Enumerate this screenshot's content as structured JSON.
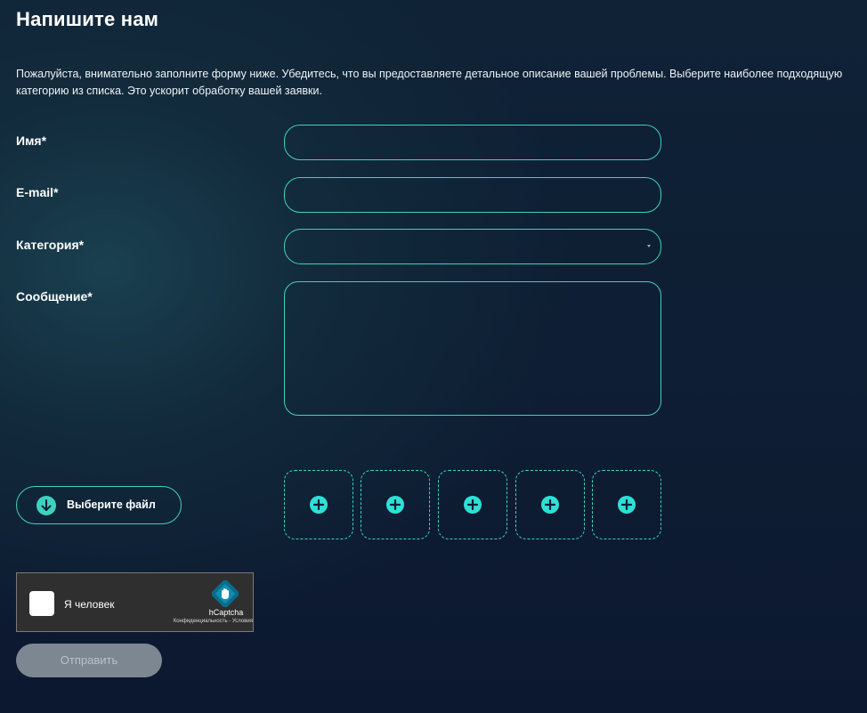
{
  "page": {
    "title": "Напишите нам",
    "intro": "Пожалуйста, внимательно заполните форму ниже. Убедитесь, что вы предоставляете детальное описание вашей проблемы. Выберите наиболее подходящую категорию из списка. Это ускорит обработку вашей заявки."
  },
  "form": {
    "name": {
      "label": "Имя*",
      "value": "",
      "placeholder": ""
    },
    "email": {
      "label": "E-mail*",
      "value": "",
      "placeholder": ""
    },
    "category": {
      "label": "Категория*",
      "value": "",
      "icon": "chevron-down-icon"
    },
    "message": {
      "label": "Сообщение*",
      "value": "",
      "placeholder": ""
    }
  },
  "upload": {
    "button_label": "Выберите файл",
    "button_icon": "download-arrow-icon",
    "slot_icon": "plus-circle-icon",
    "slot_count": 5
  },
  "captcha": {
    "label": "Я человек",
    "brand": "hCaptcha",
    "links": "Конфиденциальность - Условия"
  },
  "submit": {
    "label": "Отправить"
  },
  "colors": {
    "accent": "#3fd1c0",
    "plus": "#2ee0d6",
    "submit_bg": "#7d8792",
    "captcha_bg": "#2f2f2f"
  }
}
